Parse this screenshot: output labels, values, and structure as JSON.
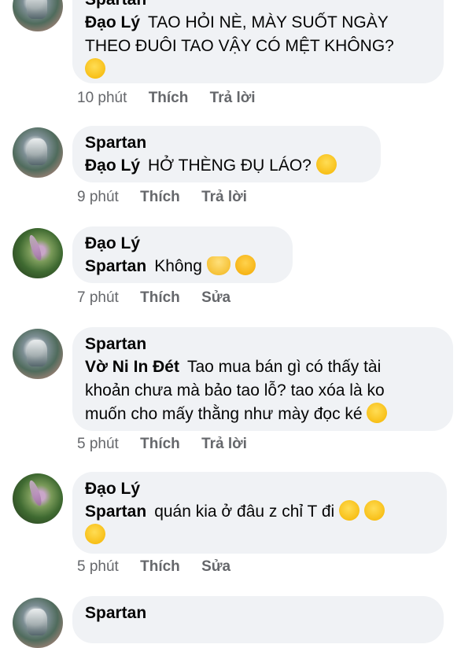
{
  "comments": [
    {
      "author": "Spartan",
      "avatar": "spartan",
      "mention": "Đạo Lý",
      "text_lines": [
        "TAO HỎI NÈ, MÀY SUỐT NGÀY",
        "THEO ĐUÔI TAO VẬY CÓ MỆT KHÔNG?"
      ],
      "emoji": "rolling-on-floor-laughing-icon",
      "time": "10 phút",
      "like": "Thích",
      "action": "Trả lời"
    },
    {
      "author": "Spartan",
      "avatar": "spartan",
      "mention": "Đạo Lý",
      "text": "HỞ THÈNG ĐỤ LÁO?",
      "emoji": "grinning-squinting-face-icon",
      "time": "9 phút",
      "like": "Thích",
      "action": "Trả lời"
    },
    {
      "author": "Đạo Lý",
      "avatar": "daoly",
      "mention": "Spartan",
      "text": "Không",
      "emoji": [
        "heart-hands-icon",
        "face-blowing-kiss-icon"
      ],
      "time": "7 phút",
      "like": "Thích",
      "action": "Sửa"
    },
    {
      "author": "Spartan",
      "avatar": "spartan",
      "mention": "Vờ Ni In Đét",
      "text_lines": [
        "Tao mua bán gì có thấy tài",
        "khoản chưa mà bảo tao lỗ? tao xóa là ko",
        "muốn cho mấy thằng như mày đọc ké"
      ],
      "emoji": "rolling-on-floor-laughing-icon",
      "time": "5 phút",
      "like": "Thích",
      "action": "Trả lời"
    },
    {
      "author": "Đạo Lý",
      "avatar": "daoly",
      "mention": "Spartan",
      "text": "quán kia ở đâu z chỉ T đi",
      "emoji": "rolling-on-floor-laughing-icon",
      "time": "5 phút",
      "like": "Thích",
      "action": "Sửa"
    },
    {
      "author": "Spartan",
      "avatar": "spartan"
    }
  ]
}
